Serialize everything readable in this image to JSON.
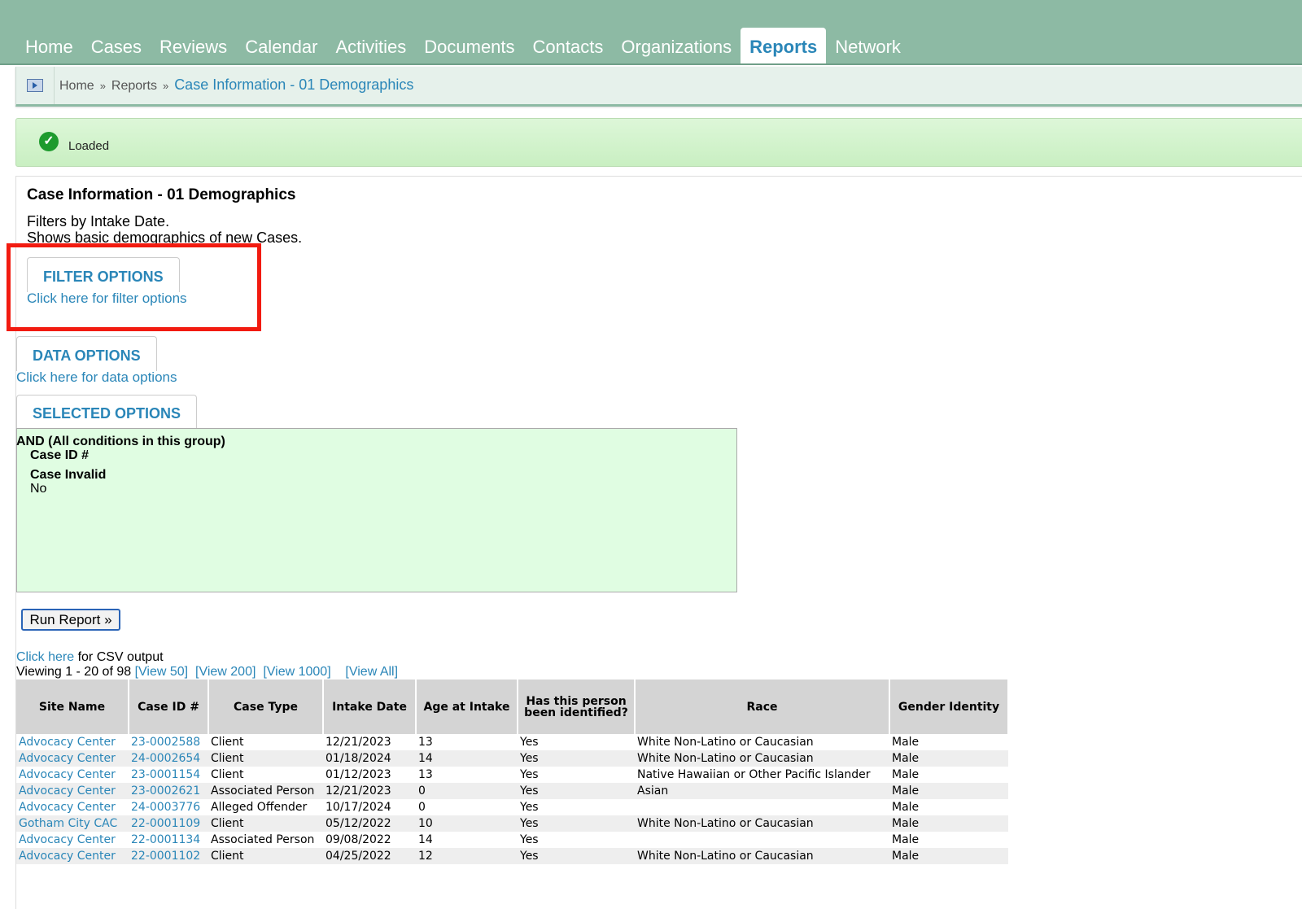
{
  "nav": {
    "tabs": [
      "Home",
      "Cases",
      "Reviews",
      "Calendar",
      "Activities",
      "Documents",
      "Contacts",
      "Organizations",
      "Reports",
      "Network"
    ],
    "active": "Reports"
  },
  "breadcrumb": {
    "home": "Home",
    "sep": "»",
    "reports": "Reports",
    "current": "Case Information - 01 Demographics"
  },
  "status": {
    "message": "Loaded"
  },
  "report": {
    "title": "Case Information - 01 Demographics",
    "desc_line1": "Filters by Intake Date.",
    "desc_line2": "Shows basic demographics of new Cases."
  },
  "filter_options": {
    "label": "FILTER OPTIONS",
    "link": "Click here for filter options"
  },
  "data_options": {
    "label": "DATA OPTIONS",
    "link": "Click here for data options"
  },
  "selected_options": {
    "label": "SELECTED OPTIONS",
    "group": "AND (All conditions in this group)",
    "cond1": "Case ID #",
    "cond2": "Case Invalid",
    "cond2_value": "No"
  },
  "run_button": "Run Report »",
  "csv": {
    "link": "Click here",
    "text": " for CSV output"
  },
  "viewing": {
    "text": "Viewing 1 - 20 of 98 ",
    "links": [
      "[View 50]",
      "[View 200]",
      "[View 1000]",
      "[View All]"
    ]
  },
  "table": {
    "headers": [
      "Site Name",
      "Case ID #",
      "Case Type",
      "Intake Date",
      "Age at Intake",
      "Has this person been identified?",
      "Race",
      "Gender Identity"
    ],
    "rows": [
      [
        "Advocacy Center",
        "23-0002588",
        "Client",
        "12/21/2023",
        "13",
        "Yes",
        "White Non-Latino or Caucasian",
        "Male"
      ],
      [
        "Advocacy Center",
        "24-0002654",
        "Client",
        "01/18/2024",
        "14",
        "Yes",
        "White Non-Latino or Caucasian",
        "Male"
      ],
      [
        "Advocacy Center",
        "23-0001154",
        "Client",
        "01/12/2023",
        "13",
        "Yes",
        "Native Hawaiian or Other Pacific Islander",
        "Male"
      ],
      [
        "Advocacy Center",
        "23-0002621",
        "Associated Person",
        "12/21/2023",
        "0",
        "Yes",
        "Asian",
        "Male"
      ],
      [
        "Advocacy Center",
        "24-0003776",
        "Alleged Offender",
        "10/17/2024",
        "0",
        "Yes",
        "",
        "Male"
      ],
      [
        "Gotham City CAC",
        "22-0001109",
        "Client",
        "05/12/2022",
        "10",
        "Yes",
        "White Non-Latino or Caucasian",
        "Male"
      ],
      [
        "Advocacy Center",
        "22-0001134",
        "Associated Person",
        "09/08/2022",
        "14",
        "Yes",
        "",
        "Male"
      ],
      [
        "Advocacy Center",
        "22-0001102",
        "Client",
        "04/25/2022",
        "12",
        "Yes",
        "White Non-Latino or Caucasian",
        "Male"
      ]
    ]
  }
}
